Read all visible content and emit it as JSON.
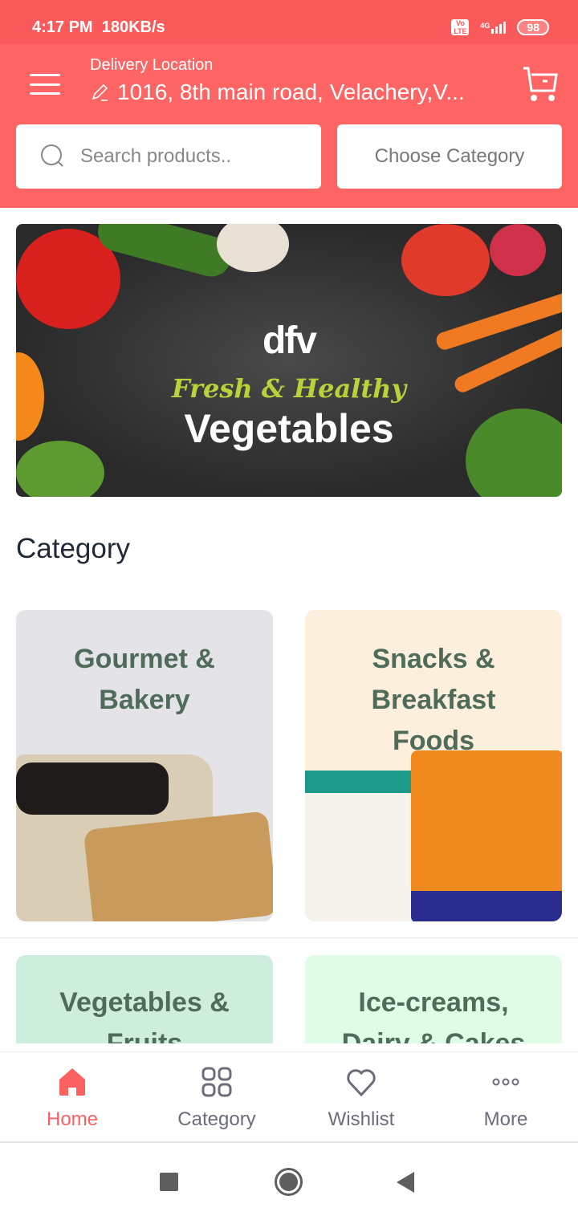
{
  "status_bar": {
    "time": "4:17 PM",
    "speed": "180KB/s",
    "network": "4G",
    "volte": "Vo LTE",
    "battery": "98"
  },
  "header": {
    "delivery_label": "Delivery Location",
    "address": "1016, 8th main road, Velachery,V...",
    "search_placeholder": "Search products..",
    "category_button": "Choose Category",
    "accent": "#fd6464"
  },
  "banner": {
    "logo": "dfv",
    "tagline": "Fresh & Healthy",
    "title": "Vegetables"
  },
  "category": {
    "heading": "Category",
    "items": [
      {
        "label": "Gourmet & Bakery",
        "lines": [
          "Gourmet &",
          "Bakery"
        ],
        "bg": "#e3e3e8"
      },
      {
        "label": "Snacks & Breakfast Foods",
        "lines": [
          "Snacks &",
          "Breakfast",
          "Foods"
        ],
        "bg": "#fcefdc"
      },
      {
        "label": "Vegetables & Fruits",
        "lines": [
          "Vegetables &",
          "Fruits"
        ],
        "bg": "#cdeedc"
      },
      {
        "label": "Ice-creams, Dairy & Cakes",
        "lines": [
          "Ice-creams,",
          "Dairy & Cakes"
        ],
        "bg": "#e0fbe6"
      }
    ]
  },
  "bottom_nav": [
    {
      "label": "Home",
      "icon": "home-icon",
      "active": true
    },
    {
      "label": "Category",
      "icon": "grid-icon"
    },
    {
      "label": "Wishlist",
      "icon": "heart-icon"
    },
    {
      "label": "More",
      "icon": "more-icon"
    }
  ]
}
